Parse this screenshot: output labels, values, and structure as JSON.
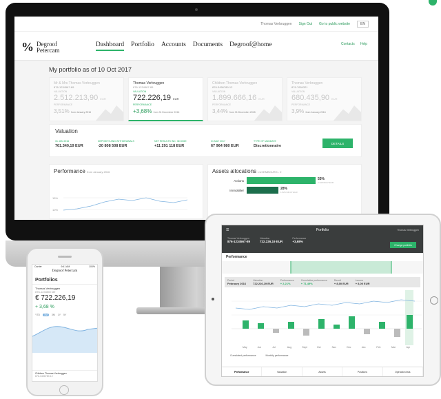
{
  "brand": {
    "mark": "%",
    "name_line1": "Degroof",
    "name_line2": "Petercam"
  },
  "desktop": {
    "topbar": {
      "user": "Thomas Verbruggen",
      "sign_out": "Sign Out",
      "public_site": "Go to public website",
      "lang": "EN"
    },
    "nav": [
      "Dashboard",
      "Portfolio",
      "Accounts",
      "Documents",
      "Degroof@home"
    ],
    "header_links": {
      "contacts": "Contacts",
      "help": "Help"
    },
    "portfolio_title": "My portfolio as of 10 Oct 2017",
    "cards": [
      {
        "name": "Mr & Mrs Thomas Verbruggen",
        "account": "876-1234567-89",
        "label": "VALUATION",
        "amount": "2.512.213,90",
        "currency": "EUR",
        "perf_label": "PERFORMANCE",
        "perf": "3,51%",
        "since": "from January 2016"
      },
      {
        "name": "Thomas Verbruggen",
        "account": "876-1234567-89",
        "label": "VALUATION",
        "amount": "722.226,19",
        "currency": "EUR",
        "perf_label": "PERFORMANCE",
        "perf": "+3,68%",
        "since": "from 31 December 2016"
      },
      {
        "name": "Children Thomas Verbruggen",
        "account": "876-3456789-12",
        "label": "VALUATION",
        "amount": "1.899.666,16",
        "currency": "EUR",
        "perf_label": "PERFORMANCE",
        "perf": "3,44%",
        "since": "from 31 December 2015"
      },
      {
        "name": "Thomas Verbruggen",
        "account": "876-7654321",
        "label": "VALUATION",
        "amount": "680.435,90",
        "currency": "EUR",
        "perf_label": "PERFORMANCE",
        "perf": "3,9%",
        "since": "from January 2016"
      }
    ],
    "valuation": {
      "title": "Valuation",
      "cols": [
        {
          "label": "31 JAN 2016",
          "value": "701.340,19 EUR"
        },
        {
          "label": "DEPOSITS AND WITHDRAWALS",
          "value": "-20 808 508 EUR"
        },
        {
          "label": "NET RESULTS INC. INCOME",
          "value": "+11 291 118 EUR"
        },
        {
          "label": "31 MAY 2017",
          "value": "67 964 980 EUR"
        },
        {
          "label": "TYPE OF MANDATE",
          "value": "Discretionnaire"
        }
      ],
      "details_button": "DETAILS"
    },
    "performance": {
      "title": "Performance",
      "since": "from January 2016",
      "ticks": [
        "15%",
        "10%"
      ]
    },
    "assets": {
      "title": "Assets allocations",
      "subtitle": "LUXEMBOURG - 2",
      "rows": [
        {
          "label": "Actions",
          "pct": "55%",
          "amount": "2.345.00.07 EUR",
          "value": 55,
          "color": "#2db36a"
        },
        {
          "label": "Immobilier",
          "pct": "28%",
          "amount": "1.525.345.07 EUR",
          "value": 28,
          "color": "#1c6e4c"
        }
      ]
    }
  },
  "phone": {
    "time": "9:41 AM",
    "carrier": "Carrier",
    "battery": "100%",
    "logo": "Degroof Petercam",
    "title": "Portfolios",
    "account_name": "Thomas Verbruggen",
    "account_no": "876-1234567-89",
    "amount": "€ 722.226,19",
    "perf": "+ 3,68 %",
    "range_tabs": [
      "YTD",
      "1M",
      "3M",
      "1Y",
      "5Y"
    ],
    "footer_name": "Children Thomas Verbruggen",
    "footer_account": "876-3456789-12"
  },
  "tablet": {
    "time": "9:41 AM",
    "title": "Portfolio",
    "user": "Thomas Verbruggen",
    "strip": [
      {
        "label": "Thomas Verbruggen",
        "value": "876-1234567-89"
      },
      {
        "label": "Valuation",
        "value": "722.226,19 EUR"
      },
      {
        "label": "Performance",
        "value": "+3,68%"
      }
    ],
    "change_button": "Change portfolio",
    "performance_title": "Performance",
    "stats": [
      {
        "label": "Period",
        "value": "February 2016"
      },
      {
        "label": "Valuation",
        "value": "722.226,19 EUR"
      },
      {
        "label": "Performance",
        "value": "+ 2,21%"
      },
      {
        "label": "Cumulative performance",
        "value": "+ 71,49%"
      },
      {
        "label": "Result",
        "value": "+ 8,00 EUR"
      },
      {
        "label": "Income",
        "value": "+ 8,00 EUR"
      }
    ],
    "months": [
      "May",
      "Jun",
      "Jul",
      "Aug",
      "Sept",
      "Oct",
      "Nov",
      "Dec",
      "Jan",
      "Feb",
      "Mar",
      "Apr"
    ],
    "legend": [
      "Cumulated performance",
      "Monthly performance"
    ],
    "tabs": [
      "Performance",
      "Valuation",
      "Assets",
      "Positions",
      "Operation lists"
    ]
  }
}
